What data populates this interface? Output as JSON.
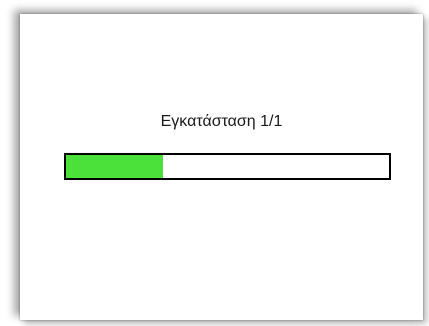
{
  "installer": {
    "status_text": "Εγκατάσταση 1/1",
    "progress_fraction": 0.3,
    "progress_color": "#4be13a"
  }
}
